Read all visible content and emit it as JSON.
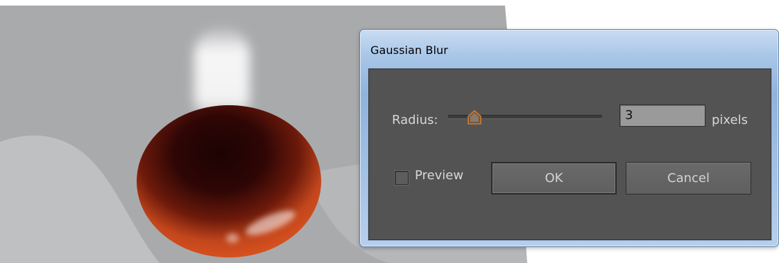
{
  "dialog": {
    "title": "Gaussian Blur",
    "radius_label": "Radius:",
    "radius_value": "3",
    "radius_unit": "pixels",
    "slider_fraction": 0.17,
    "preview_label": "Preview",
    "preview_checked": false,
    "ok_label": "OK",
    "cancel_label": "Cancel"
  },
  "colors": {
    "canvas_gray": "#a9aaac",
    "dialog_body": "#535353",
    "title_bar": "#9dbde3",
    "slider_thumb": "#c8752a",
    "drop_dark": "#2a0606",
    "drop_orange": "#d24a1f"
  },
  "icons": {
    "slider_thumb": "slider-thumb-icon",
    "checkbox": "checkbox-icon"
  }
}
